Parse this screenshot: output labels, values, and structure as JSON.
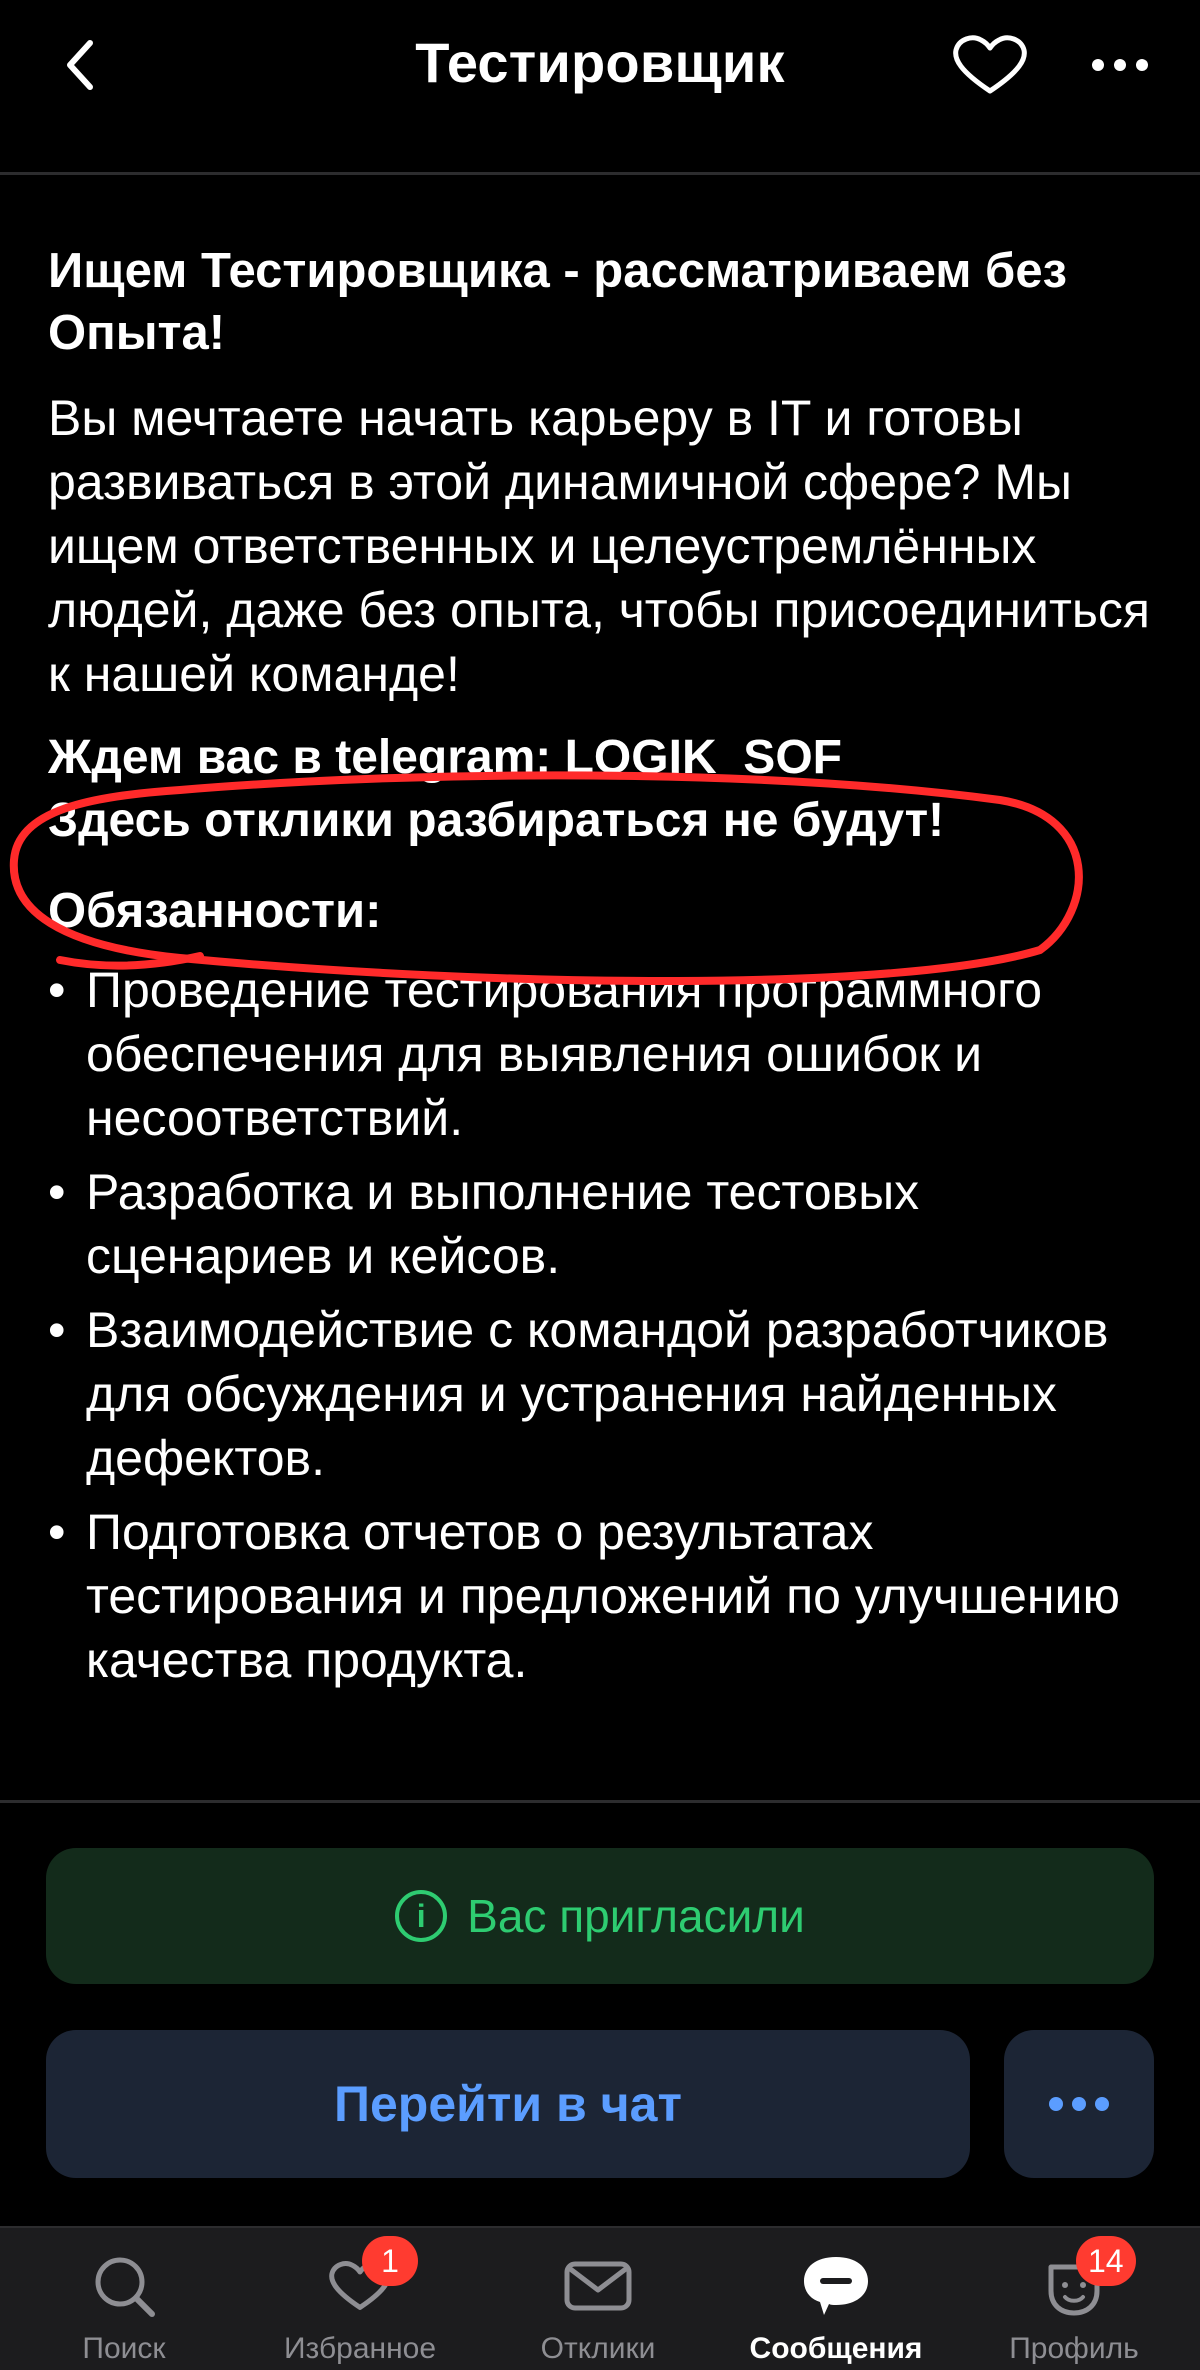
{
  "header": {
    "title": "Тестировщик"
  },
  "vacancy": {
    "headline": "Ищем Тестировщика - рассматриваем без Опыта!",
    "intro": "Вы мечтаете начать карьеру в IT и готовы развиваться в этой динамичной сфере? Мы ищем ответственных и целеустремлённых людей, даже без опыта, чтобы присоединиться к нашей команде!",
    "contact_line1": "Ждем вас в telegram: LOGIK_SOF",
    "contact_line2": "Здесь отклики разбираться не будут!",
    "duties_title": "Обязанности:",
    "duties": [
      "Проведение тестирования программного обеспечения для выявления ошибок и несоответствий.",
      "Разработка и выполнение тестовых сценариев и кейсов.",
      "Взаимодействие с командой разработчиков для обсуждения и устранения найденных дефектов.",
      "Подготовка отчетов о результатах тестирования и предложений по улучшению качества продукта."
    ]
  },
  "actions": {
    "invited_label": "Вас пригласили",
    "chat_label": "Перейти в чат"
  },
  "tabbar": {
    "items": [
      {
        "label": "Поиск",
        "icon": "search-icon"
      },
      {
        "label": "Избранное",
        "icon": "heart-icon",
        "badge": "1"
      },
      {
        "label": "Отклики",
        "icon": "envelope-icon"
      },
      {
        "label": "Сообщения",
        "icon": "chat-bubble-icon",
        "active": true
      },
      {
        "label": "Профиль",
        "icon": "profile-face-icon",
        "badge": "14"
      }
    ]
  },
  "colors": {
    "background": "#000000",
    "accent_blue": "#5b9dff",
    "invited_green": "#2ecc71",
    "badge_red": "#ff3b30",
    "annotation_red": "#ff2a2a"
  }
}
